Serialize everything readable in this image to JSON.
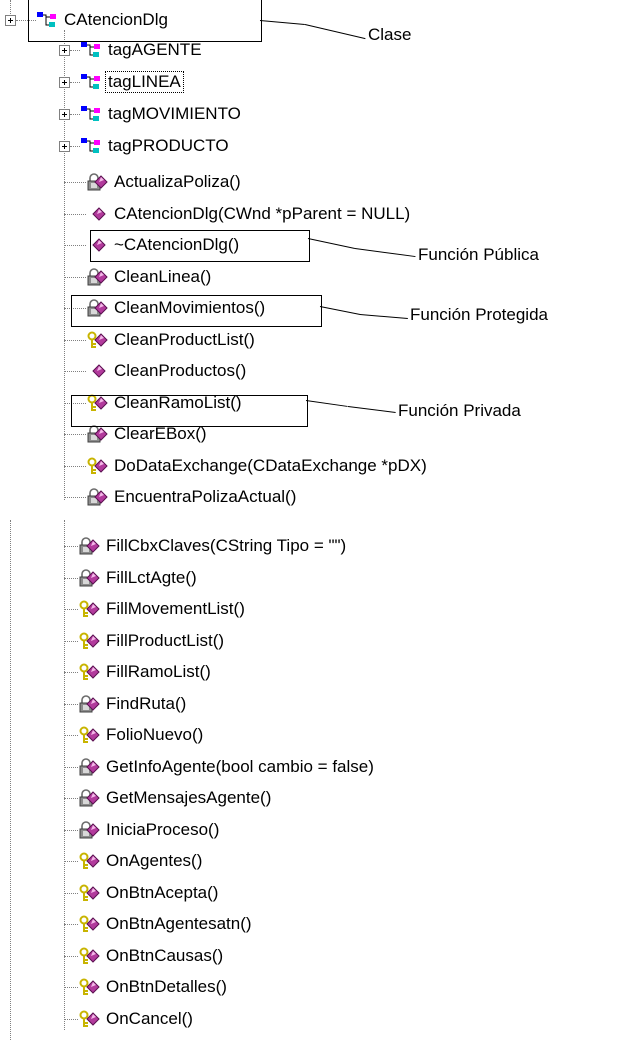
{
  "tree": {
    "root": {
      "label": "CAtencionDlg",
      "icon": "class-icon"
    },
    "nested_types": [
      {
        "label": "tagAGENTE",
        "icon": "struct-icon"
      },
      {
        "label": "tagLINEA",
        "icon": "struct-icon"
      },
      {
        "label": "tagMOVIMIENTO",
        "icon": "struct-icon"
      },
      {
        "label": "tagPRODUCTO",
        "icon": "struct-icon"
      }
    ],
    "members_top": [
      {
        "label": "ActualizaPoliza()",
        "access": "protected"
      },
      {
        "label": "CAtencionDlg(CWnd *pParent = NULL)",
        "access": "public"
      },
      {
        "label": "~CAtencionDlg()",
        "access": "public"
      },
      {
        "label": "CleanLinea()",
        "access": "protected"
      },
      {
        "label": "CleanMovimientos()",
        "access": "protected"
      },
      {
        "label": "CleanProductList()",
        "access": "private"
      },
      {
        "label": "CleanProductos()",
        "access": "public"
      },
      {
        "label": "CleanRamoList()",
        "access": "private"
      },
      {
        "label": "ClearEBox()",
        "access": "protected"
      },
      {
        "label": "DoDataExchange(CDataExchange *pDX)",
        "access": "private"
      },
      {
        "label": "EncuentraPolizaActual()",
        "access": "protected"
      }
    ],
    "members_bottom": [
      {
        "label": "FillCbxClaves(CString Tipo = \"\")",
        "access": "protected"
      },
      {
        "label": "FillLctAgte()",
        "access": "protected"
      },
      {
        "label": "FillMovementList()",
        "access": "private"
      },
      {
        "label": "FillProductList()",
        "access": "private"
      },
      {
        "label": "FillRamoList()",
        "access": "private"
      },
      {
        "label": "FindRuta()",
        "access": "protected"
      },
      {
        "label": "FolioNuevo()",
        "access": "private"
      },
      {
        "label": "GetInfoAgente(bool cambio = false)",
        "access": "protected"
      },
      {
        "label": "GetMensajesAgente()",
        "access": "protected"
      },
      {
        "label": "IniciaProceso()",
        "access": "protected"
      },
      {
        "label": "OnAgentes()",
        "access": "private"
      },
      {
        "label": "OnBtnAcepta()",
        "access": "private"
      },
      {
        "label": "OnBtnAgentesatn()",
        "access": "private"
      },
      {
        "label": "OnBtnCausas()",
        "access": "private"
      },
      {
        "label": "OnBtnDetalles()",
        "access": "private"
      },
      {
        "label": "OnCancel()",
        "access": "private"
      }
    ]
  },
  "annotations": {
    "clase": "Clase",
    "publica": "Función Pública",
    "protegida": "Función Protegida",
    "privada": "Función Privada"
  },
  "colors": {
    "member_purple": "#b23a9c",
    "lock_gray": "#8c8c8c",
    "key_yellow": "#c8b400",
    "class_blue": "#0000ff",
    "class_magenta": "#ff00ff",
    "class_cyan": "#00c0c0",
    "tree_line": "#808080"
  }
}
